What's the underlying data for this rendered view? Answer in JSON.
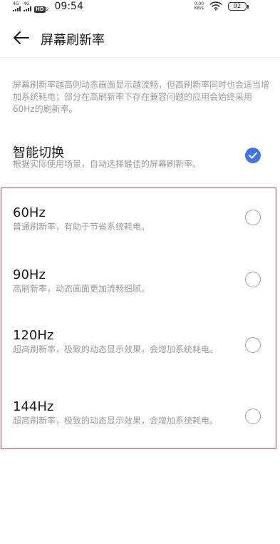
{
  "status_bar": {
    "sim1_label": "4G",
    "sim2_label": "4G",
    "hd_label": "HD",
    "hd_sub": "2",
    "time": "09:54",
    "net_speed_value": "0.00",
    "net_speed_unit": "KB/s",
    "battery": "92"
  },
  "header": {
    "title": "屏幕刷新率"
  },
  "description": "屏幕刷新率越高则动态画面显示越流畅，但高刷新率同时也会适当增加系统耗电；部分在高刷新率下存在兼容问题的应用会始终采用60Hz的刷新率。",
  "smart_switch": {
    "title": "智能切换",
    "subtitle": "根据实际使用场景，自动选择最佳的屏幕刷新率。",
    "checked": true
  },
  "options": [
    {
      "title": "60Hz",
      "subtitle": "普通刷新率，有助于节省系统耗电。",
      "checked": false
    },
    {
      "title": "90Hz",
      "subtitle": "高刷新率，动态画面更加流畅细腻。",
      "checked": false
    },
    {
      "title": "120Hz",
      "subtitle": "超高刷新率，极致的动态显示效果，会增加系统耗电。",
      "checked": false
    },
    {
      "title": "144Hz",
      "subtitle": "超高刷新率，极致的动态显示效果，会增加系统耗电。",
      "checked": false
    }
  ],
  "colors": {
    "accent": "#3f75e8",
    "highlight_border": "#e0404a",
    "secondary_text": "#9a9a9a"
  }
}
